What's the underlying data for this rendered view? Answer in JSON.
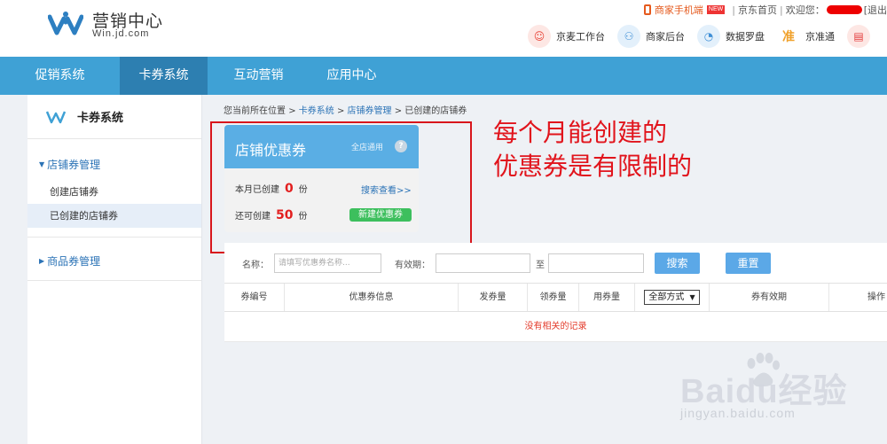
{
  "brand": {
    "title": "营销中心",
    "subtitle": "Win.jd.com"
  },
  "topbar": {
    "mobile": "商家手机端",
    "new_badge": "NEW",
    "jd_home": "京东首页",
    "welcome": "欢迎您：",
    "logout": "[退出"
  },
  "tools": [
    {
      "label": "京麦工作台",
      "icon": "jingmai-icon",
      "color": "#e8473b"
    },
    {
      "label": "商家后台",
      "icon": "merchant-icon",
      "color": "#3f8fd6"
    },
    {
      "label": "数据罗盘",
      "icon": "compass-icon",
      "color": "#3f8fd6"
    },
    {
      "label": "京准通",
      "icon": "jzt-icon",
      "color": "#f0a12b"
    },
    {
      "label": "",
      "icon": "shop-icon",
      "color": "#e33b3b"
    }
  ],
  "nav": [
    {
      "label": "促销系统",
      "active": false
    },
    {
      "label": "卡券系统",
      "active": true
    },
    {
      "label": "互动营销",
      "active": false
    },
    {
      "label": "应用中心",
      "active": false
    }
  ],
  "sidebar": {
    "title": "卡券系统",
    "group1": "店铺券管理",
    "items": [
      {
        "label": "创建店铺券",
        "active": false
      },
      {
        "label": "已创建的店铺券",
        "active": true
      }
    ],
    "group2": "商品券管理"
  },
  "breadcrumb": {
    "prefix": "您当前所在位置",
    "sep": ">",
    "l1": "卡券系统",
    "l2": "店铺券管理",
    "l3": "已创建的店铺券"
  },
  "card": {
    "title": "店铺优惠券",
    "scope": "全店通用",
    "help": "?",
    "created_label": "本月已创建",
    "created_value": "0",
    "remaining_label": "还可创建",
    "remaining_value": "50",
    "unit": "份",
    "search_link": "搜索查看>>",
    "new_button": "新建优惠券"
  },
  "annotation": {
    "line1": "每个月能创建的",
    "line2": "优惠券是有限制的"
  },
  "search": {
    "name_label": "名称：",
    "name_placeholder": "请填写优惠券名称...",
    "period_label": "有效期：",
    "to": "至",
    "search_button": "搜索",
    "reset_button": "重置"
  },
  "table": {
    "headers": [
      "券编号",
      "优惠券信息",
      "发券量",
      "领券量",
      "用券量",
      "券有效期",
      "操作"
    ],
    "filter_value": "全部方式",
    "empty": "没有相关的记录"
  },
  "watermark": {
    "text": "Baidu经验",
    "sub": "jingyan.baidu.com"
  }
}
